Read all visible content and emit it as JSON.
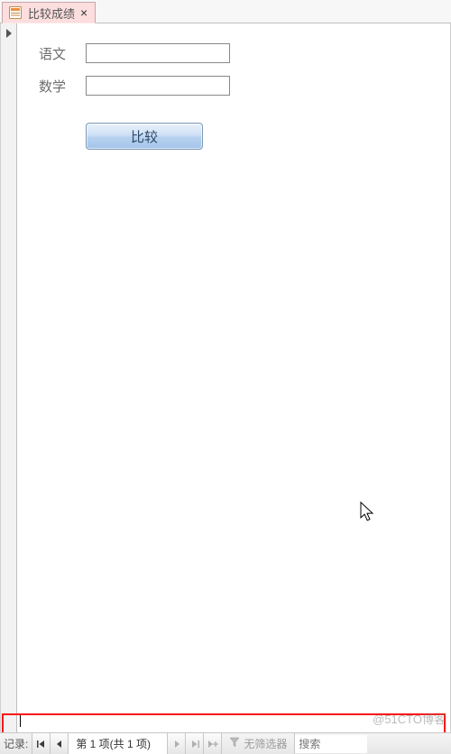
{
  "tab": {
    "title": "比较成绩"
  },
  "form": {
    "fields": [
      {
        "label": "语文",
        "value": ""
      },
      {
        "label": "数学",
        "value": ""
      }
    ],
    "compare_label": "比较"
  },
  "nav": {
    "record_label": "记录:",
    "counter": "第 1 项(共 1 项)",
    "filter_label": "无筛选器",
    "search_placeholder": "搜索"
  },
  "watermark": "@51CTO博客"
}
